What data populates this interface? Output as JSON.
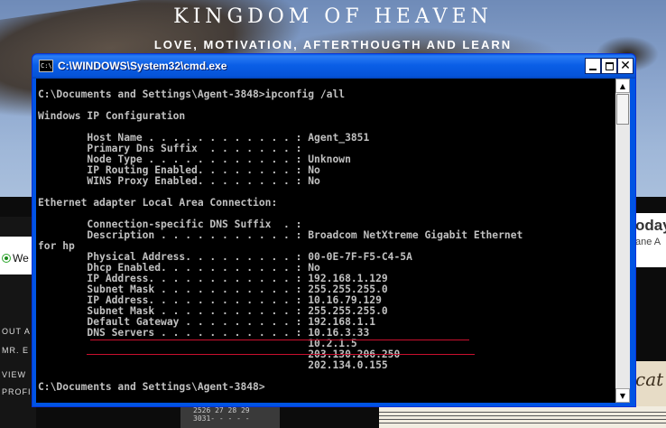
{
  "background": {
    "site_title": "KINGDOM OF HEAVEN",
    "tagline": "LOVE, MOTIVATION, AFTERTHOUGTH AND LEARN",
    "left_label": "We",
    "side_links": [
      "OUT A",
      "MR. E",
      "VIEW",
      "PROFI"
    ],
    "right_texts": [
      "oday",
      "ane A",
      "cat"
    ],
    "calendar_text": [
      "2526 27 28 29",
      "3031- - - - -"
    ]
  },
  "window": {
    "title": "C:\\WINDOWS\\System32\\cmd.exe",
    "icon_label": "C:\\",
    "minimize_icon": "minimize-icon",
    "maximize_icon": "maximize-icon",
    "close_icon": "close-icon",
    "close_glyph": "✕",
    "scroll_up_glyph": "▲",
    "scroll_down_glyph": "▼"
  },
  "console": {
    "lines": [
      "C:\\Documents and Settings\\Agent-3848>ipconfig /all",
      "",
      "Windows IP Configuration",
      "",
      "        Host Name . . . . . . . . . . . . : Agent_3851",
      "        Primary Dns Suffix  . . . . . . . :",
      "        Node Type . . . . . . . . . . . . : Unknown",
      "        IP Routing Enabled. . . . . . . . : No",
      "        WINS Proxy Enabled. . . . . . . . : No",
      "",
      "Ethernet adapter Local Area Connection:",
      "",
      "        Connection-specific DNS Suffix  . :",
      "        Description . . . . . . . . . . . : Broadcom NetXtreme Gigabit Ethernet",
      "for hp",
      "        Physical Address. . . . . . . . . : 00-0E-7F-F5-C4-5A",
      "        Dhcp Enabled. . . . . . . . . . . : No",
      "        IP Address. . . . . . . . . . . . : 192.168.1.129",
      "        Subnet Mask . . . . . . . . . . . : 255.255.255.0",
      "        IP Address. . . . . . . . . . . . : 10.16.79.129",
      "        Subnet Mask . . . . . . . . . . . : 255.255.255.0",
      "        Default Gateway . . . . . . . . . : 192.168.1.1",
      "        DNS Servers . . . . . . . . . . . : 10.16.3.33",
      "                                            10.2.1.5",
      "                                            203.130.206.250",
      "                                            202.134.0.155",
      "",
      "C:\\Documents and Settings\\Agent-3848>"
    ],
    "text_color": "#c0c0c0",
    "underline_color": "#c8102e"
  }
}
